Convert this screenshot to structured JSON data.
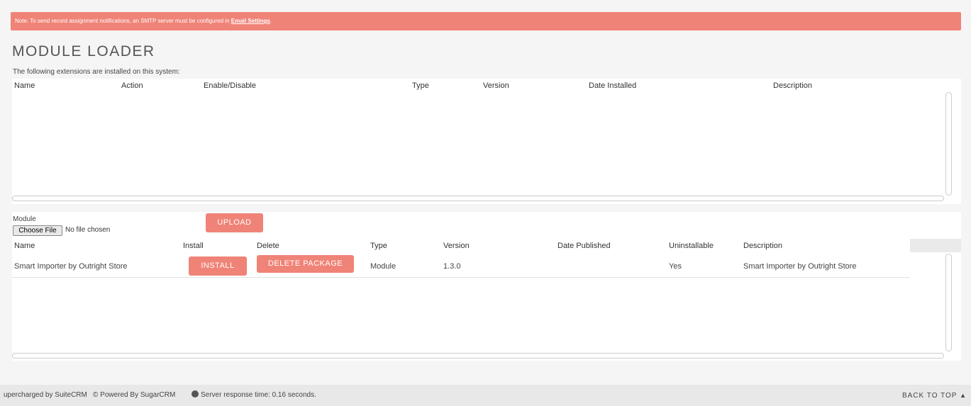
{
  "notice": {
    "text": "Note: To send record assignment notifications, an SMTP server must be configured in ",
    "link": "Email Settings",
    "end": "."
  },
  "title": "MODULE LOADER",
  "installed": {
    "caption": "The following extensions are installed on this system:",
    "columns": [
      "Name",
      "Action",
      "Enable/Disable",
      "Type",
      "Version",
      "Date Installed",
      "Description"
    ]
  },
  "upload": {
    "label": "Module",
    "choose_button": "Choose File",
    "file_status": "No file chosen",
    "upload_button": "UPLOAD"
  },
  "packages": {
    "columns": [
      "Name",
      "Install",
      "Delete",
      "Type",
      "Version",
      "Date Published",
      "Uninstallable",
      "Description"
    ],
    "rows": [
      {
        "name": "Smart Importer by Outright Store",
        "install_button": "INSTALL",
        "delete_button": "DELETE PACKAGE",
        "type": "Module",
        "version": "1.3.0",
        "date_published": "",
        "uninstallable": "Yes",
        "description": "Smart Importer by Outright Store"
      }
    ]
  },
  "footer": {
    "supercharged": "upercharged by SuiteCRM",
    "powered": "© Powered By SugarCRM",
    "response": "Server response time: 0.16 seconds.",
    "back_to_top": "BACK TO TOP"
  },
  "colors": {
    "accent": "#f08377",
    "footer_bg": "#e8e8e8",
    "page_bg": "#f5f5f5"
  }
}
